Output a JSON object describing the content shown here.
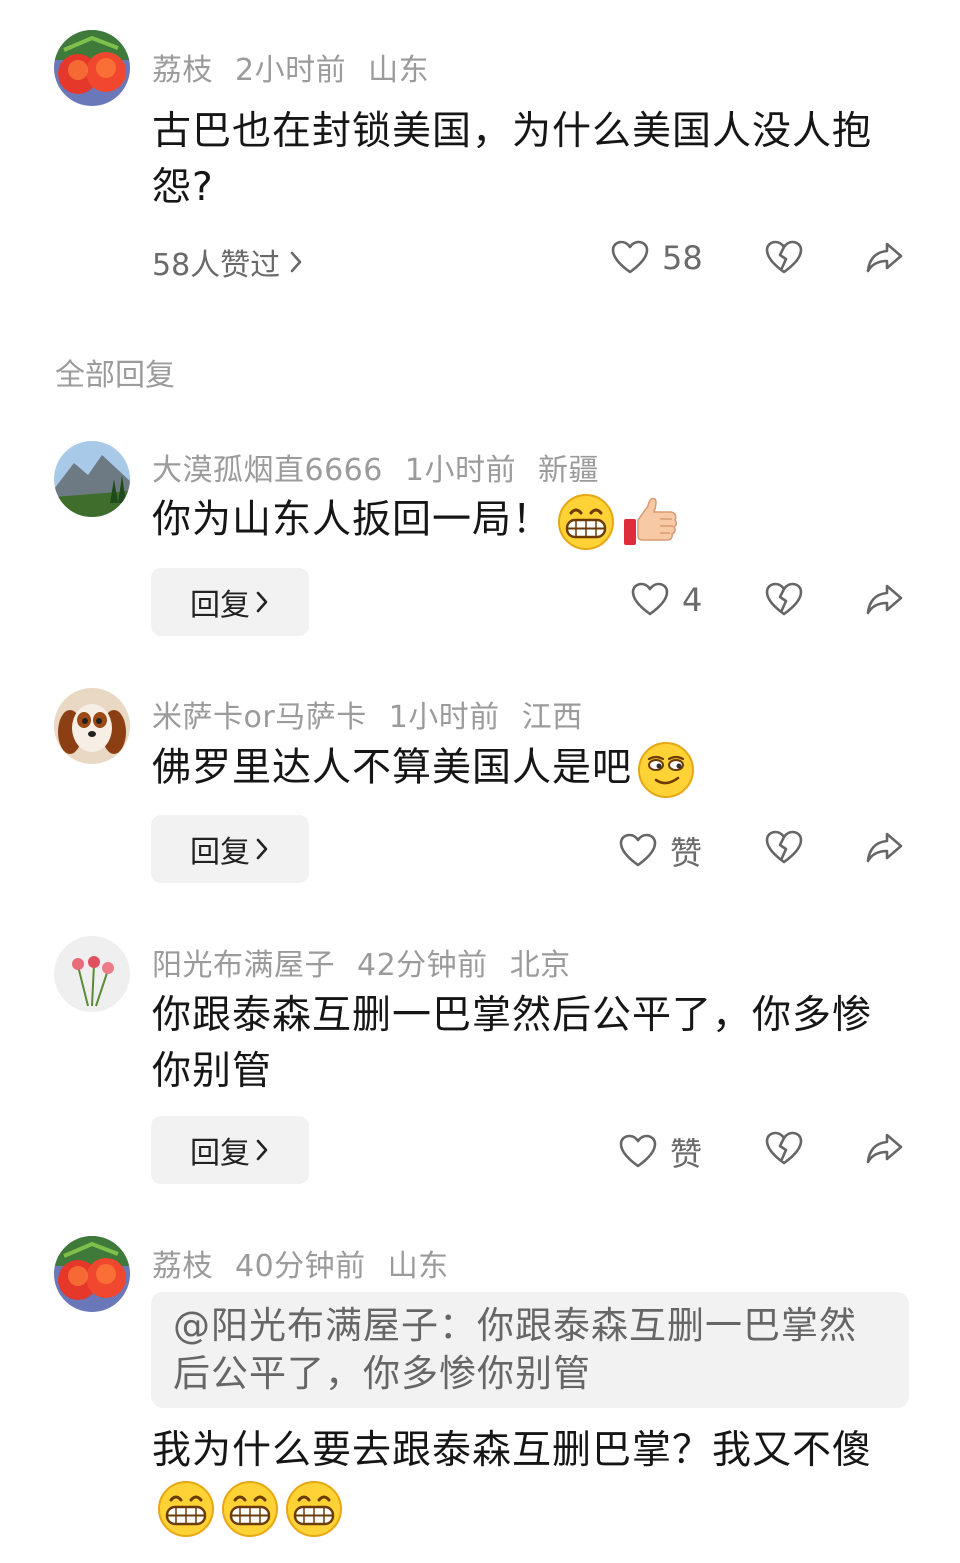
{
  "main_comment": {
    "username": "荔枝",
    "time": "2小时前",
    "location": "山东",
    "text": "古巴也在封锁美国，为什么美国人没人抱怨?",
    "likes_summary": "58人赞过",
    "like_count": "58"
  },
  "section_title": "全部回复",
  "replies": [
    {
      "username": "大漠孤烟直6666",
      "time": "1小时前",
      "location": "新疆",
      "text": "你为山东人扳回一局！",
      "reply_label": "回复",
      "like_label": "4"
    },
    {
      "username": "米萨卡or马萨卡",
      "time": "1小时前",
      "location": "江西",
      "text": "佛罗里达人不算美国人是吧",
      "reply_label": "回复",
      "like_label": "赞"
    },
    {
      "username": "阳光布满屋子",
      "time": "42分钟前",
      "location": "北京",
      "text": "你跟泰森互删一巴掌然后公平了，你多惨你别管",
      "reply_label": "回复",
      "like_label": "赞"
    },
    {
      "username": "荔枝",
      "time": "40分钟前",
      "location": "山东",
      "quote": "@阳光布满屋子：你跟泰森互删一巴掌然后公平了，你多惨你别管",
      "text": "我为什么要去跟泰森互删巴掌？我又不傻"
    }
  ],
  "icons": {
    "like": "heart-icon",
    "dislike": "broken-heart-icon",
    "share": "share-arrow-icon",
    "chevron": "chevron-right-icon"
  },
  "colors": {
    "meta": "#9b9b9b",
    "text": "#161616",
    "button_bg": "#f2f2f2"
  }
}
